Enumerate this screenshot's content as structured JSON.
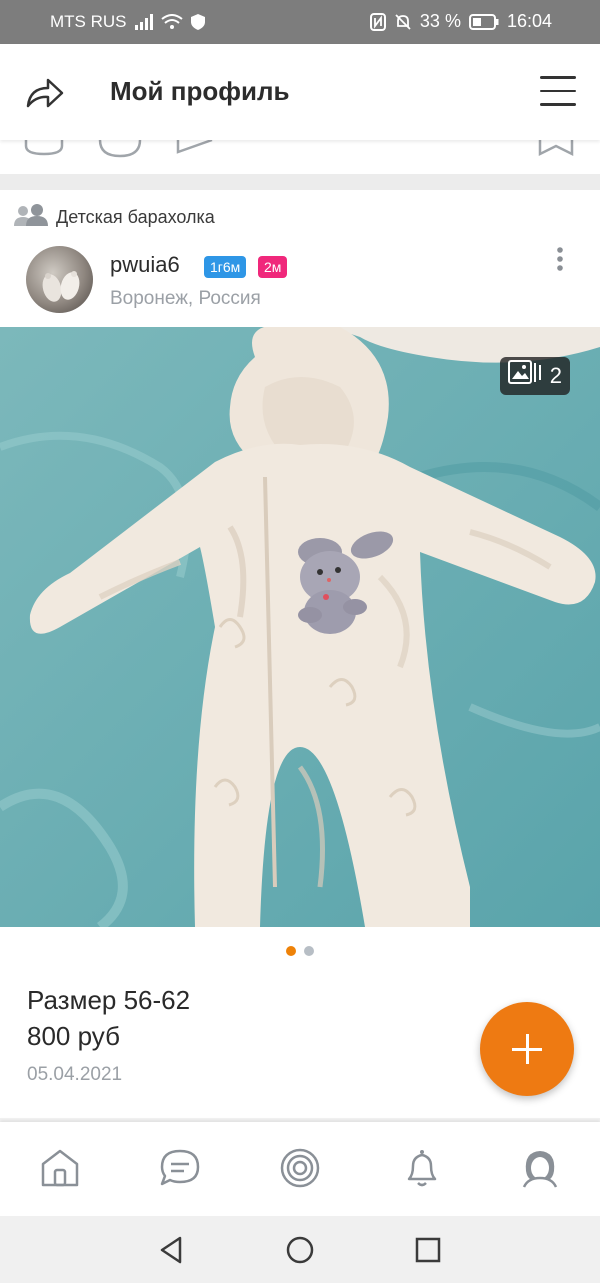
{
  "status_bar": {
    "carrier": "MTS RUS",
    "battery_percent": "33 %",
    "time": "16:04"
  },
  "header": {
    "title": "Мой профиль"
  },
  "post": {
    "group_name": "Детская барахолка",
    "author": {
      "name": "pwuia6",
      "badge_1": "1г6м",
      "badge_2": "2м",
      "location": "Воронеж, Россия"
    },
    "photo_count": "2",
    "carousel": {
      "total": 2,
      "active": 1
    },
    "text_line_1": "Размер 56-62",
    "text_line_2": "800 руб",
    "date": "05.04.2021"
  },
  "icons": {
    "share": "share-icon",
    "menu": "hamburger-menu-icon",
    "group": "group-icon",
    "more": "more-vertical-icon",
    "photos": "photo-stack-icon",
    "add": "plus-icon",
    "nav": [
      "home-icon",
      "messages-icon",
      "discussions-icon",
      "notifications-icon",
      "profile-icon"
    ],
    "system": [
      "back-icon",
      "home-circle-icon",
      "recents-icon"
    ]
  },
  "colors": {
    "accent_orange": "#ee7a12",
    "badge_blue": "#2e96e6",
    "badge_pink": "#f0287b",
    "status_bar": "#7d7d7d"
  }
}
